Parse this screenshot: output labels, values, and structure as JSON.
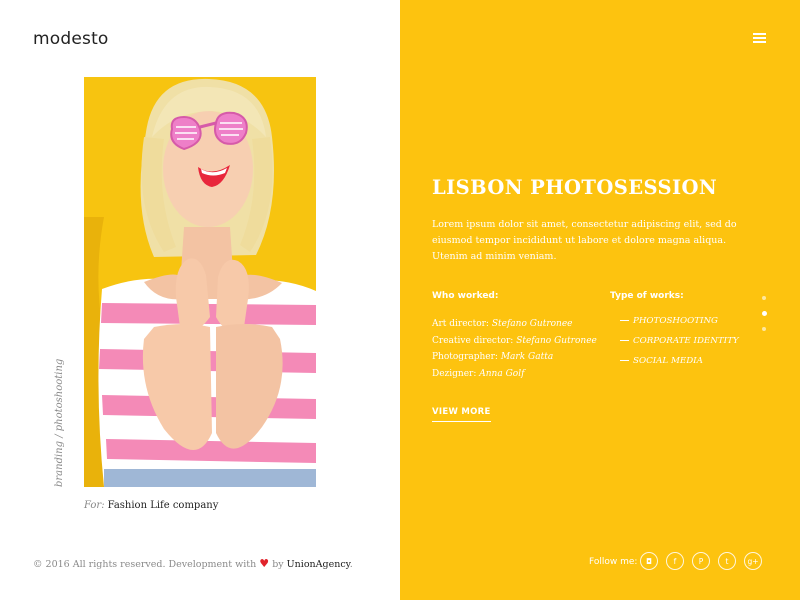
{
  "brand": {
    "logo": "modesto"
  },
  "left": {
    "vertical_caption": "branding / photoshooting",
    "client_prefix": "For:",
    "client_name": "Fashion Life company",
    "footer": {
      "text_before": "© 2016 All rights reserved. Development with",
      "heart": "♥",
      "by": "by",
      "agency": "UnionAgency",
      "end": "."
    }
  },
  "project": {
    "title": "LISBON PHOTOSESSION",
    "description": "Lorem ipsum dolor sit amet, consectetur adipiscing elit, sed do eiusmod tempor incididunt ut labore et dolore magna aliqua. Utenim ad minim veniam.",
    "who_heading": "Who worked:",
    "credits": [
      {
        "role": "Art director:",
        "name": "Stefano Gutronee"
      },
      {
        "role": "Creative director:",
        "name": "Stefano Gutronee"
      },
      {
        "role": "Photographer:",
        "name": "Mark Gatta"
      },
      {
        "role": "Dezigner:",
        "name": "Anna Golf"
      }
    ],
    "types_heading": "Type of works:",
    "types": [
      "PHOTOSHOOTING",
      "CORPORATE IDENTITY",
      "SOCIAL MEDIA"
    ],
    "view_more": "VIEW MORE"
  },
  "pager": {
    "count": 3,
    "active_index": 1
  },
  "social": {
    "label": "Follow me:",
    "icons": [
      {
        "name": "instagram-icon",
        "glyph": "◘"
      },
      {
        "name": "facebook-icon",
        "glyph": "f"
      },
      {
        "name": "pinterest-icon",
        "glyph": "P"
      },
      {
        "name": "twitter-icon",
        "glyph": "t"
      },
      {
        "name": "google-plus-icon",
        "glyph": "g+"
      }
    ]
  },
  "colors": {
    "accent_yellow": "#fdc30f",
    "heart_red": "#e0232b",
    "text_dark": "#222222"
  }
}
